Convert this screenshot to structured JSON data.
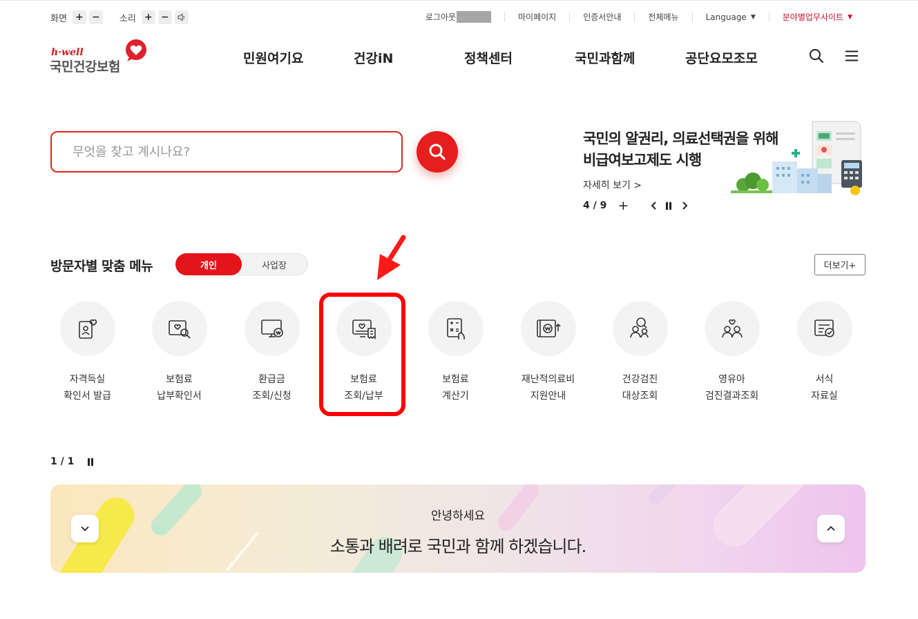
{
  "util": {
    "screen_label": "화면",
    "sound_label": "소리",
    "plus": "+",
    "minus": "−",
    "logout": "로그아웃",
    "mypage": "마이페이지",
    "cert": "인증서안내",
    "allmenu": "전체메뉴",
    "language": "Language",
    "sites": "분야별업무사이트",
    "caret": "▼"
  },
  "logo": {
    "brand": "h·well",
    "name": "국민건강보험"
  },
  "gnb": [
    "민원여기요",
    "건강iN",
    "정책센터",
    "국민과함께",
    "공단요모조모"
  ],
  "search": {
    "placeholder": "무엇을 찾고 계시나요?"
  },
  "notice": {
    "line1": "국민의 알권리, 의료선택권을 위해",
    "line2": "비급여보고제도 시행",
    "more": "자세히 보기 >",
    "page": "4 / 9",
    "plus": "+"
  },
  "visitor": {
    "title": "방문자별 맞춤 메뉴",
    "tab_personal": "개인",
    "tab_business": "사업장",
    "more": "더보기+",
    "items": [
      {
        "l1": "자격득실",
        "l2": "확인서 발급",
        "icon": "id-card-icon"
      },
      {
        "l1": "보험료",
        "l2": "납부확인서",
        "icon": "document-search-icon"
      },
      {
        "l1": "환급금",
        "l2": "조회/신청",
        "icon": "monitor-won-icon"
      },
      {
        "l1": "보험료",
        "l2": "조회/납부",
        "icon": "bill-receipt-icon"
      },
      {
        "l1": "보험료",
        "l2": "계산기",
        "icon": "calculator-icon"
      },
      {
        "l1": "재난적의료비",
        "l2": "지원안내",
        "icon": "won-support-icon"
      },
      {
        "l1": "건강검진",
        "l2": "대상조회",
        "icon": "people-search-icon"
      },
      {
        "l1": "영유아",
        "l2": "검진결과조회",
        "icon": "family-icon"
      },
      {
        "l1": "서식",
        "l2": "자료실",
        "icon": "form-check-icon"
      }
    ]
  },
  "pager": {
    "page": "1 / 1"
  },
  "banner": {
    "hello": "안녕하세요",
    "message": "소통과 배려로 국민과 함께 하겠습니다."
  },
  "colors": {
    "brand_red": "#e4141b",
    "highlight": "#ff0000"
  }
}
